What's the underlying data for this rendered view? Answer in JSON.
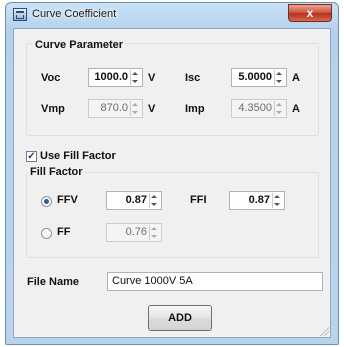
{
  "window": {
    "title": "Curve Coefficient",
    "close_glyph": "x"
  },
  "curve_parameter": {
    "title": "Curve Parameter",
    "voc": {
      "label": "Voc",
      "value": "1000.0",
      "unit": "V"
    },
    "isc": {
      "label": "Isc",
      "value": "5.0000",
      "unit": "A"
    },
    "vmp": {
      "label": "Vmp",
      "value": "870.0",
      "unit": "V"
    },
    "imp": {
      "label": "Imp",
      "value": "4.3500",
      "unit": "A"
    }
  },
  "use_fill_factor": {
    "label": "Use Fill Factor",
    "checked": true,
    "check_glyph": "✓"
  },
  "fill_factor": {
    "title": "Fill Factor",
    "ffv": {
      "label": "FFV",
      "value": "0.87",
      "selected": true
    },
    "ffi": {
      "label": "FFI",
      "value": "0.87"
    },
    "ff": {
      "label": "FF",
      "value": "0.76",
      "selected": false
    }
  },
  "file_name": {
    "label": "File Name",
    "value": "Curve 1000V 5A"
  },
  "add_button": {
    "label": "ADD"
  },
  "colors": {
    "title_gradient_top": "#c9e1f5",
    "close_red": "#cf5a43",
    "client_bg": "#f0f0f0"
  }
}
